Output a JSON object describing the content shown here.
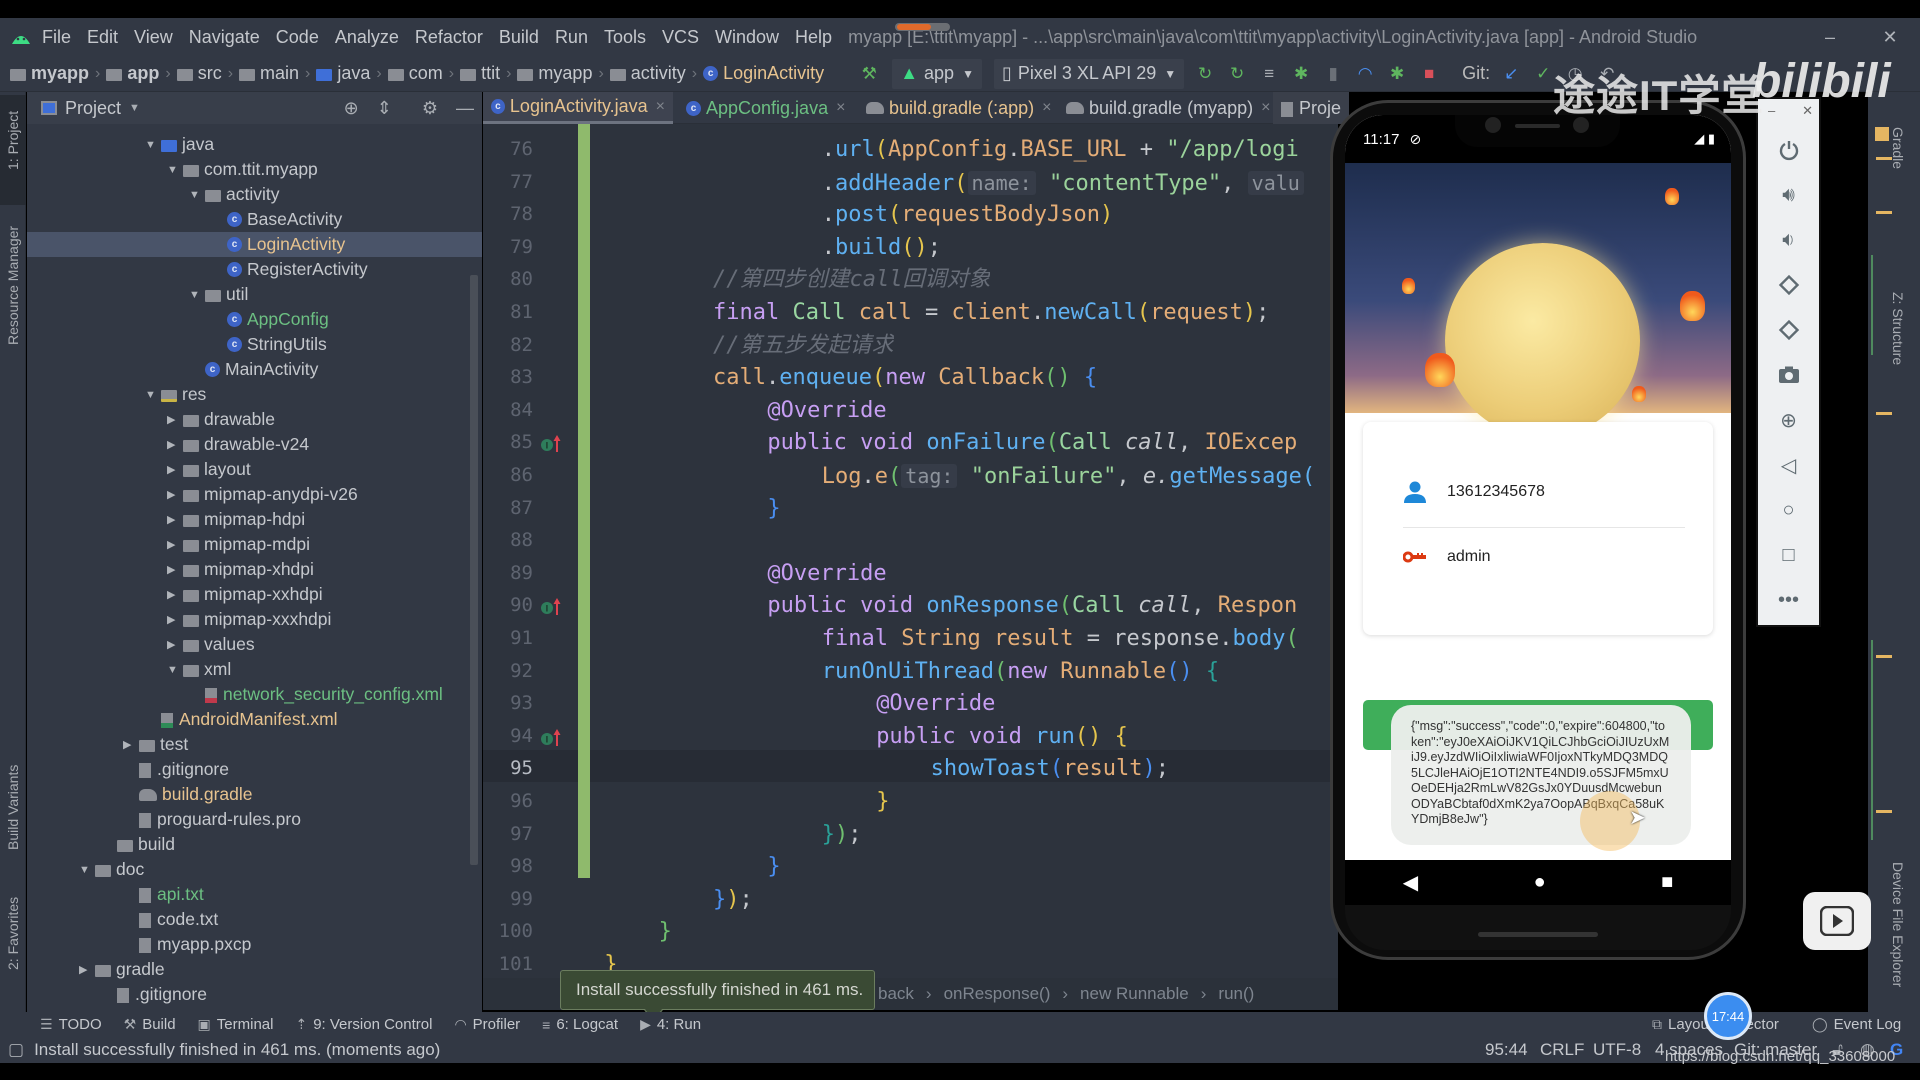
{
  "app": {
    "window_title": "myapp [E:\\ttit\\myapp] - ...\\app\\src\\main\\java\\com\\ttit\\myapp\\activity\\LoginActivity.java [app] - Android Studio",
    "menu": [
      "File",
      "Edit",
      "View",
      "Navigate",
      "Code",
      "Analyze",
      "Refactor",
      "Build",
      "Run",
      "Tools",
      "VCS",
      "Window",
      "Help"
    ],
    "window_controls": {
      "minimize": "–",
      "restore": "❐",
      "close": "✕"
    }
  },
  "breadcrumb": [
    "myapp",
    "app",
    "src",
    "main",
    "java",
    "com",
    "ttit",
    "myapp",
    "activity",
    "LoginActivity"
  ],
  "toolbar": {
    "run_config": "app",
    "device": "Pixel 3 XL API 29",
    "git_label": "Git:"
  },
  "left_strip": {
    "project_tab": "1: Project",
    "resource_manager": "Resource Manager",
    "build_variants": "Build Variants",
    "favorites": "2: Favorites"
  },
  "project_panel": {
    "title": "Project",
    "tree": [
      {
        "label": "java",
        "depth": 4,
        "expanded": true,
        "kind": "folder-blue"
      },
      {
        "label": "com.ttit.myapp",
        "depth": 5,
        "expanded": true,
        "kind": "package"
      },
      {
        "label": "activity",
        "depth": 6,
        "expanded": true,
        "kind": "package"
      },
      {
        "label": "BaseActivity",
        "depth": 7,
        "kind": "class"
      },
      {
        "label": "LoginActivity",
        "depth": 7,
        "kind": "class",
        "selected": true,
        "color": "orange"
      },
      {
        "label": "RegisterActivity",
        "depth": 7,
        "kind": "class"
      },
      {
        "label": "util",
        "depth": 6,
        "expanded": true,
        "kind": "package"
      },
      {
        "label": "AppConfig",
        "depth": 7,
        "kind": "class",
        "color": "green"
      },
      {
        "label": "StringUtils",
        "depth": 7,
        "kind": "class"
      },
      {
        "label": "MainActivity",
        "depth": 6,
        "kind": "class"
      },
      {
        "label": "res",
        "depth": 4,
        "expanded": true,
        "kind": "res"
      },
      {
        "label": "drawable",
        "depth": 5,
        "expanded": false,
        "kind": "folder"
      },
      {
        "label": "drawable-v24",
        "depth": 5,
        "expanded": false,
        "kind": "folder"
      },
      {
        "label": "layout",
        "depth": 5,
        "expanded": false,
        "kind": "folder"
      },
      {
        "label": "mipmap-anydpi-v26",
        "depth": 5,
        "expanded": false,
        "kind": "folder"
      },
      {
        "label": "mipmap-hdpi",
        "depth": 5,
        "expanded": false,
        "kind": "folder"
      },
      {
        "label": "mipmap-mdpi",
        "depth": 5,
        "expanded": false,
        "kind": "folder"
      },
      {
        "label": "mipmap-xhdpi",
        "depth": 5,
        "expanded": false,
        "kind": "folder"
      },
      {
        "label": "mipmap-xxhdpi",
        "depth": 5,
        "expanded": false,
        "kind": "folder"
      },
      {
        "label": "mipmap-xxxhdpi",
        "depth": 5,
        "expanded": false,
        "kind": "folder"
      },
      {
        "label": "values",
        "depth": 5,
        "expanded": false,
        "kind": "folder"
      },
      {
        "label": "xml",
        "depth": 5,
        "expanded": true,
        "kind": "folder"
      },
      {
        "label": "network_security_config.xml",
        "depth": 6,
        "kind": "xml",
        "color": "green"
      },
      {
        "label": "AndroidManifest.xml",
        "depth": 4,
        "kind": "manifest",
        "color": "orange"
      },
      {
        "label": "test",
        "depth": 3,
        "expanded": false,
        "kind": "folder"
      },
      {
        "label": ".gitignore",
        "depth": 3,
        "kind": "file"
      },
      {
        "label": "build.gradle",
        "depth": 3,
        "kind": "gradle",
        "color": "orange"
      },
      {
        "label": "proguard-rules.pro",
        "depth": 3,
        "kind": "file"
      },
      {
        "label": "build",
        "depth": 2,
        "kind": "folder"
      },
      {
        "label": "doc",
        "depth": 1,
        "expanded": true,
        "kind": "folder"
      },
      {
        "label": "api.txt",
        "depth": 3,
        "kind": "file",
        "color": "green"
      },
      {
        "label": "code.txt",
        "depth": 3,
        "kind": "file"
      },
      {
        "label": "myapp.pxcp",
        "depth": 3,
        "kind": "file"
      },
      {
        "label": "gradle",
        "depth": 1,
        "expanded": false,
        "kind": "folder"
      },
      {
        "label": ".gitignore",
        "depth": 2,
        "kind": "file"
      }
    ]
  },
  "editor": {
    "tabs": [
      {
        "label": "LoginActivity.java",
        "active": true,
        "icon": "class"
      },
      {
        "label": "AppConfig.java",
        "active": false,
        "icon": "class",
        "color": "green"
      },
      {
        "label": "build.gradle (:app)",
        "active": false,
        "icon": "gradle",
        "color": "orange"
      },
      {
        "label": "build.gradle (myapp)",
        "active": false,
        "icon": "gradle"
      },
      {
        "label": "Proje",
        "active": false,
        "icon": "file"
      }
    ],
    "current_line": 95,
    "lines": [
      {
        "n": 76,
        "indent": 8,
        "tokens": [
          [
            ".",
            ""
          ],
          [
            "url",
            "fn"
          ],
          [
            "(",
            "p1"
          ],
          [
            "AppConfig",
            "var"
          ],
          [
            ".",
            ""
          ],
          [
            "BASE_URL",
            "var"
          ],
          [
            " + ",
            ""
          ],
          [
            "\"/app/logi",
            "str"
          ]
        ]
      },
      {
        "n": 77,
        "indent": 8,
        "tokens": [
          [
            ".",
            ""
          ],
          [
            "addHeader",
            "fn"
          ],
          [
            "(",
            "p1"
          ],
          [
            "name:",
            "hint"
          ],
          [
            " ",
            ""
          ],
          [
            "\"contentType\"",
            "str"
          ],
          [
            ", ",
            ""
          ],
          [
            "valu",
            "hint"
          ]
        ]
      },
      {
        "n": 78,
        "indent": 8,
        "tokens": [
          [
            ".",
            ""
          ],
          [
            "post",
            "fn"
          ],
          [
            "(",
            "p1"
          ],
          [
            "requestBodyJson",
            "var"
          ],
          [
            ")",
            "p1"
          ]
        ]
      },
      {
        "n": 79,
        "indent": 8,
        "tokens": [
          [
            ".",
            ""
          ],
          [
            "build",
            "fn"
          ],
          [
            "()",
            "p1"
          ],
          [
            ";",
            ""
          ]
        ]
      },
      {
        "n": 80,
        "indent": 0,
        "tokens": [
          [
            "//第四步创建call回调对象",
            "cmt"
          ]
        ]
      },
      {
        "n": 81,
        "indent": 0,
        "tokens": [
          [
            "final ",
            "kw"
          ],
          [
            "Call ",
            "ty"
          ],
          [
            "call",
            "var"
          ],
          [
            " = ",
            ""
          ],
          [
            "client",
            "var"
          ],
          [
            ".",
            ""
          ],
          [
            "newCall",
            "fn"
          ],
          [
            "(",
            "p1"
          ],
          [
            "request",
            "var"
          ],
          [
            ")",
            "p1"
          ],
          [
            ";",
            ""
          ]
        ]
      },
      {
        "n": 82,
        "indent": 0,
        "tokens": [
          [
            "//第五步发起请求",
            "cmt"
          ]
        ]
      },
      {
        "n": 83,
        "indent": 0,
        "tokens": [
          [
            "call",
            "var"
          ],
          [
            ".",
            ""
          ],
          [
            "enqueue",
            "fn"
          ],
          [
            "(",
            "p1"
          ],
          [
            "new ",
            "kw"
          ],
          [
            "Callback",
            "var"
          ],
          [
            "()",
            "p2"
          ],
          [
            " {",
            "p3"
          ]
        ]
      },
      {
        "n": 84,
        "indent": 4,
        "tokens": [
          [
            "@Override",
            "ann"
          ]
        ]
      },
      {
        "n": 85,
        "indent": 4,
        "tokens": [
          [
            "public ",
            "kw"
          ],
          [
            "void ",
            "kw"
          ],
          [
            "onFailure",
            "fn"
          ],
          [
            "(",
            "p2"
          ],
          [
            "Call ",
            "ty"
          ],
          [
            "call",
            "ital"
          ],
          [
            ", ",
            ""
          ],
          [
            "IOExcep",
            "var"
          ]
        ],
        "override_marker": true
      },
      {
        "n": 86,
        "indent": 8,
        "tokens": [
          [
            "Log",
            "var"
          ],
          [
            ".",
            ""
          ],
          [
            "e",
            "var"
          ],
          [
            "(",
            "p2"
          ],
          [
            "tag:",
            "hint"
          ],
          [
            " ",
            ""
          ],
          [
            "\"onFailure\"",
            "str"
          ],
          [
            ", ",
            ""
          ],
          [
            "e.",
            "ital"
          ],
          [
            "getMessage(",
            "fn"
          ]
        ]
      },
      {
        "n": 87,
        "indent": 4,
        "tokens": [
          [
            "}",
            "p3"
          ]
        ]
      },
      {
        "n": 88,
        "indent": 0,
        "tokens": []
      },
      {
        "n": 89,
        "indent": 4,
        "tokens": [
          [
            "@Override",
            "ann"
          ]
        ]
      },
      {
        "n": 90,
        "indent": 4,
        "tokens": [
          [
            "public ",
            "kw"
          ],
          [
            "void ",
            "kw"
          ],
          [
            "onResponse",
            "fn"
          ],
          [
            "(",
            "p2"
          ],
          [
            "Call ",
            "ty"
          ],
          [
            "call",
            "ital"
          ],
          [
            ", ",
            ""
          ],
          [
            "Respon",
            "var"
          ]
        ],
        "override_marker": true
      },
      {
        "n": 91,
        "indent": 8,
        "tokens": [
          [
            "final ",
            "kw"
          ],
          [
            "String ",
            "var"
          ],
          [
            "result",
            "var"
          ],
          [
            " = ",
            ""
          ],
          [
            "response",
            ""
          ],
          [
            ".",
            ""
          ],
          [
            "body",
            "fn"
          ],
          [
            "(",
            "p2"
          ]
        ]
      },
      {
        "n": 92,
        "indent": 8,
        "tokens": [
          [
            "runOnUiThread",
            "fn"
          ],
          [
            "(",
            "p2"
          ],
          [
            "new ",
            "kw"
          ],
          [
            "Runnable",
            "var"
          ],
          [
            "()",
            "p3"
          ],
          [
            " {",
            "p4"
          ]
        ]
      },
      {
        "n": 93,
        "indent": 12,
        "tokens": [
          [
            "@Override",
            "ann"
          ]
        ]
      },
      {
        "n": 94,
        "indent": 12,
        "tokens": [
          [
            "public ",
            "kw"
          ],
          [
            "void ",
            "kw"
          ],
          [
            "run",
            "fn"
          ],
          [
            "()",
            "p1"
          ],
          [
            " {",
            "p1"
          ]
        ],
        "override_marker": true
      },
      {
        "n": 95,
        "indent": 16,
        "tokens": [
          [
            "showToast",
            "fn"
          ],
          [
            "(",
            "p3"
          ],
          [
            "result",
            "var"
          ],
          [
            ")",
            "p3"
          ],
          [
            ";",
            ""
          ]
        ]
      },
      {
        "n": 96,
        "indent": 12,
        "tokens": [
          [
            "}",
            "p1"
          ]
        ]
      },
      {
        "n": 97,
        "indent": 8,
        "tokens": [
          [
            "}",
            "p4"
          ],
          [
            ")",
            "p2"
          ],
          [
            ";",
            ""
          ]
        ]
      },
      {
        "n": 98,
        "indent": 4,
        "tokens": [
          [
            "}",
            "p3"
          ]
        ]
      },
      {
        "n": 99,
        "indent": 0,
        "tokens": [
          [
            "}",
            "p3"
          ],
          [
            ")",
            "p1"
          ],
          [
            ";",
            ""
          ]
        ]
      },
      {
        "n": 100,
        "indent": -4,
        "tokens": [
          [
            "}",
            "p2"
          ]
        ]
      },
      {
        "n": 101,
        "indent": -8,
        "tokens": [
          [
            "}",
            "p1"
          ]
        ]
      }
    ],
    "breadcrumbs": [
      "back",
      "onResponse()",
      "new Runnable",
      "run()"
    ]
  },
  "tooltip": {
    "text": "Install successfully finished in 461 ms."
  },
  "phone": {
    "time": "11:17",
    "username": "13612345678",
    "password": "admin",
    "toast": "{\"msg\":\"success\",\"code\":0,\"expire\":604800,\"token\":\"eyJ0eXAiOiJKV1QiLCJhbGciOiJIUzUxMiJ9.eyJzdWIiOiIxliwiaWF0IjoxNTkyMDQ3MDQ5LCJleHAiOjE1OTI2NTE4NDI9.o5SJFM5mxUOeDEHja2RmLwV82GsJx0YDuusdMcwebunODYaBCbtaf0dXmK2ya7OopABqBxqCa58uKYDmjB8eJw\"}",
    "nav": {
      "back": "◀",
      "home": "●",
      "recents": "■"
    }
  },
  "emulator_toolbar": {
    "buttons": [
      "power",
      "volume-up",
      "volume-down",
      "rotate-left",
      "rotate-right",
      "screenshot",
      "zoom",
      "back",
      "home",
      "overview",
      "more"
    ]
  },
  "right_strip": {
    "gradle": "Gradle",
    "structure": "Z: Structure",
    "device_explorer": "Device File Explorer"
  },
  "bottom_tools": [
    {
      "label": "TODO",
      "icon": "list-icon"
    },
    {
      "label": "Build",
      "icon": "hammer-icon"
    },
    {
      "label": "Terminal",
      "icon": "terminal-icon"
    },
    {
      "label": "9: Version Control",
      "icon": "vcs-icon"
    },
    {
      "label": "Profiler",
      "icon": "gauge-icon"
    },
    {
      "label": "6: Logcat",
      "icon": "logcat-icon"
    },
    {
      "label": "4: Run",
      "icon": "run-icon"
    }
  ],
  "bottom_tools_right": {
    "layout_inspector": "Layout Inspector",
    "event_log": "Event Log"
  },
  "status": {
    "message": "Install successfully finished in 461 ms. (moments ago)",
    "position": "95:44",
    "line_sep": "CRLF",
    "encoding": "UTF-8",
    "indent": "4 spaces",
    "vcs": "Git: master"
  },
  "overlay": {
    "clock": "17:44",
    "watermark_url": "https://blog.csdn.net/qq_33608000",
    "brand_cn": "途途IT学堂",
    "brand_bili": "bilibili"
  }
}
